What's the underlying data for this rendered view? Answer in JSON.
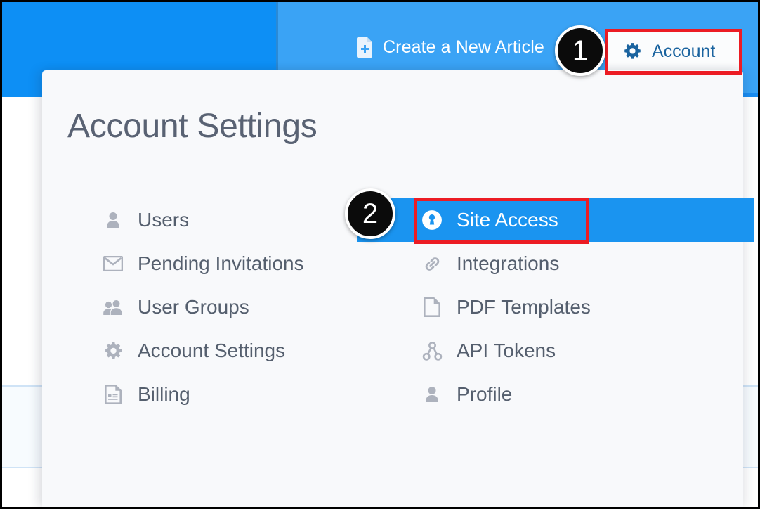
{
  "colors": {
    "header_blue": "#3aa3f5",
    "header_blue_dark": "#0d8ff5",
    "header_border": "#1a8cf0",
    "highlight_blue": "#1a94f0",
    "annotation_red": "#ec1c24",
    "badge_black": "#0b0b0b",
    "panel_bg": "#f8f9fb",
    "title_gray": "#596273",
    "label_gray": "#555f6e",
    "icon_gray": "#adb2bd",
    "account_text_blue": "#1a639f",
    "band_bg": "#f7fbfe",
    "band_border": "#cfe3f6"
  },
  "header": {
    "create_article_label": "Create a New Article",
    "create_article_icon": "document-plus-icon",
    "account_label": "Account",
    "account_icon": "gear-icon"
  },
  "panel": {
    "title": "Account Settings",
    "columns": {
      "left": [
        {
          "label": "Users",
          "icon": "user-icon"
        },
        {
          "label": "Pending Invitations",
          "icon": "envelope-icon"
        },
        {
          "label": "User Groups",
          "icon": "users-group-icon"
        },
        {
          "label": "Account Settings",
          "icon": "gear-icon"
        },
        {
          "label": "Billing",
          "icon": "invoice-icon"
        }
      ],
      "right": [
        {
          "label": "Site Access",
          "icon": "lock-keyhole-icon",
          "active": true
        },
        {
          "label": "Integrations",
          "icon": "link-chain-icon",
          "active": false
        },
        {
          "label": "PDF Templates",
          "icon": "page-icon",
          "active": false
        },
        {
          "label": "API Tokens",
          "icon": "sitemap-icon",
          "active": false
        },
        {
          "label": "Profile",
          "icon": "user-icon",
          "active": false
        }
      ]
    }
  },
  "annotations": {
    "badges": [
      {
        "number": "1",
        "target": "account-button"
      },
      {
        "number": "2",
        "target": "site-access-menu-item"
      }
    ]
  }
}
